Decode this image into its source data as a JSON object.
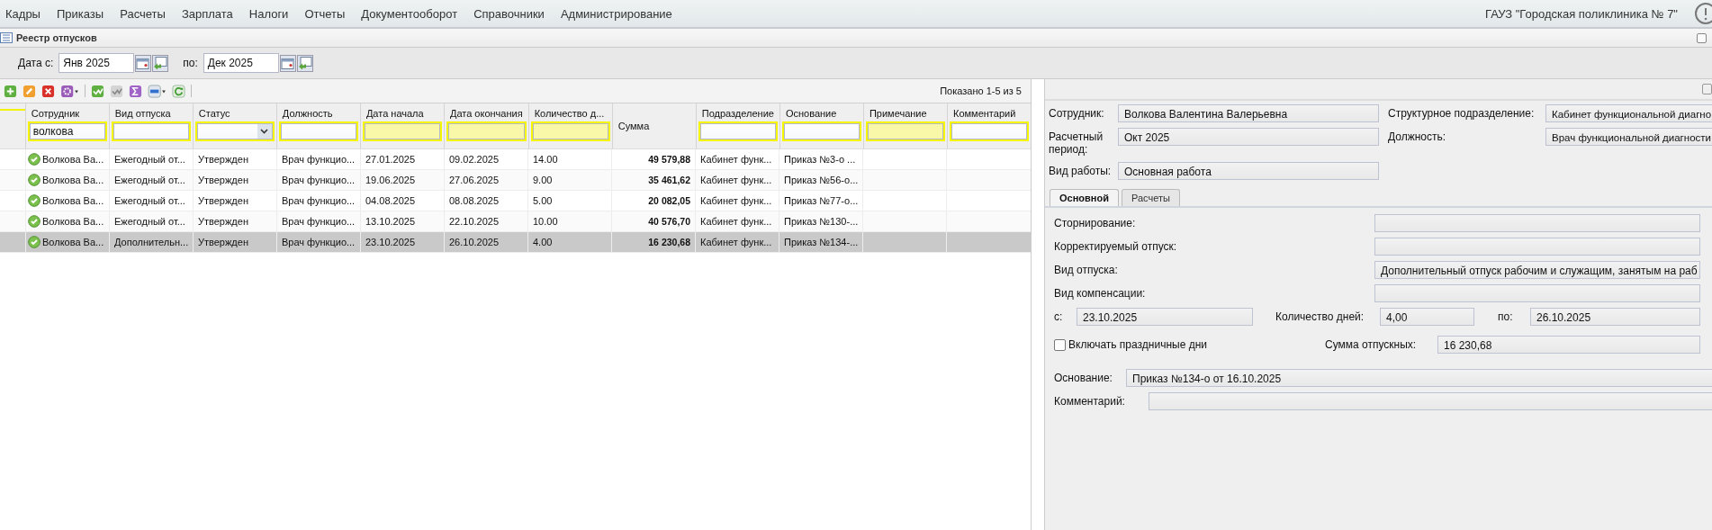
{
  "menu": [
    "Кадры",
    "Приказы",
    "Расчеты",
    "Зарплата",
    "Налоги",
    "Отчеты",
    "Документооборот",
    "Справочники",
    "Администрирование"
  ],
  "organization": "ГАУЗ \"Городская поликлиника № 7\"",
  "panel": {
    "title": "Реестр отпусков"
  },
  "date_filter": {
    "from_label": "Дата с:",
    "from": "Янв 2025",
    "to_label": "по:",
    "to": "Дек 2025"
  },
  "toolbar": {
    "status": "Показано 1-5 из 5"
  },
  "table": {
    "columns": [
      {
        "label": "Сотрудник",
        "kind": "text",
        "filter": {
          "kind": "text",
          "value": "волкова"
        }
      },
      {
        "label": "Вид отпуска",
        "kind": "text",
        "filter": {
          "kind": "text"
        }
      },
      {
        "label": "Статус",
        "kind": "text",
        "filter": {
          "kind": "select"
        }
      },
      {
        "label": "Должность",
        "kind": "text",
        "filter": {
          "kind": "text"
        }
      },
      {
        "label": "Дата начала",
        "kind": "text",
        "filter": {
          "kind": "range"
        }
      },
      {
        "label": "Дата окончания",
        "kind": "text",
        "filter": {
          "kind": "range"
        }
      },
      {
        "label": "Количество д...",
        "kind": "text",
        "filter": {
          "kind": "range"
        }
      },
      {
        "label": "Сумма",
        "kind": "amount"
      },
      {
        "label": "Подразделение",
        "kind": "text",
        "filter": {
          "kind": "text"
        }
      },
      {
        "label": "Основание",
        "kind": "text",
        "filter": {
          "kind": "text"
        }
      },
      {
        "label": "Примечание",
        "kind": "text",
        "filter": {
          "kind": "range"
        }
      },
      {
        "label": "Комментарий",
        "kind": "text",
        "filter": {
          "kind": "text"
        }
      }
    ],
    "rows": [
      {
        "selected": false,
        "cells": [
          "Волкова Ва...",
          "Ежегодный от...",
          "Утвержден",
          "Врач функцио...",
          "27.01.2025",
          "09.02.2025",
          "14.00",
          "49 579,88",
          "Кабинет функ...",
          "Приказ №3-о ...",
          "",
          ""
        ]
      },
      {
        "selected": false,
        "cells": [
          "Волкова Ва...",
          "Ежегодный от...",
          "Утвержден",
          "Врач функцио...",
          "19.06.2025",
          "27.06.2025",
          "9.00",
          "35 461,62",
          "Кабинет функ...",
          "Приказ №56-о...",
          "",
          ""
        ]
      },
      {
        "selected": false,
        "cells": [
          "Волкова Ва...",
          "Ежегодный от...",
          "Утвержден",
          "Врач функцио...",
          "04.08.2025",
          "08.08.2025",
          "5.00",
          "20 082,05",
          "Кабинет функ...",
          "Приказ №77-о...",
          "",
          ""
        ]
      },
      {
        "selected": false,
        "cells": [
          "Волкова Ва...",
          "Ежегодный от...",
          "Утвержден",
          "Врач функцио...",
          "13.10.2025",
          "22.10.2025",
          "10.00",
          "40 576,70",
          "Кабинет функ...",
          "Приказ №130-...",
          "",
          ""
        ]
      },
      {
        "selected": true,
        "cells": [
          "Волкова Ва...",
          "Дополнительн...",
          "Утвержден",
          "Врач функцио...",
          "23.10.2025",
          "26.10.2025",
          "4.00",
          "16 230,68",
          "Кабинет функ...",
          "Приказ №134-...",
          "",
          ""
        ]
      }
    ]
  },
  "details": {
    "header_left": [
      {
        "label": "Сотрудник:",
        "value": "Волкова Валентина Валерьевна"
      },
      {
        "label": "Расчетный период:",
        "value": "Окт 2025"
      },
      {
        "label": "Вид работы:",
        "value": "Основная работа"
      }
    ],
    "header_right": [
      {
        "label": "Структурное подразделение:",
        "value": "Кабинет функциональной диагно"
      },
      {
        "label": "Должность:",
        "value": "Врач функциональной диагности"
      }
    ],
    "tabs": [
      {
        "label": "Основной",
        "selected": true
      },
      {
        "label": "Расчеты",
        "selected": false
      }
    ],
    "fields": [
      {
        "label": "Сторнирование:"
      },
      {
        "label": "Корректируемый отпуск:"
      },
      {
        "label": "Вид отпуска:",
        "value": "Дополнительный отпуск рабочим и служащим, занятым на раб"
      },
      {
        "label": "Вид компенсации:"
      }
    ],
    "period": {
      "from_label": "с:",
      "from": "23.10.2025",
      "days_label": "Количество дней:",
      "days": "4,00",
      "to_label": "по:",
      "to": "26.10.2025"
    },
    "include_holidays": {
      "label": "Включать праздничные дни",
      "checked": false
    },
    "amount": {
      "label": "Сумма отпускных:",
      "value": "16 230,68"
    },
    "basis": {
      "label": "Основание:",
      "value": "Приказ №134-о от 16.10.2025"
    },
    "comment": {
      "label": "Комментарий:"
    }
  }
}
